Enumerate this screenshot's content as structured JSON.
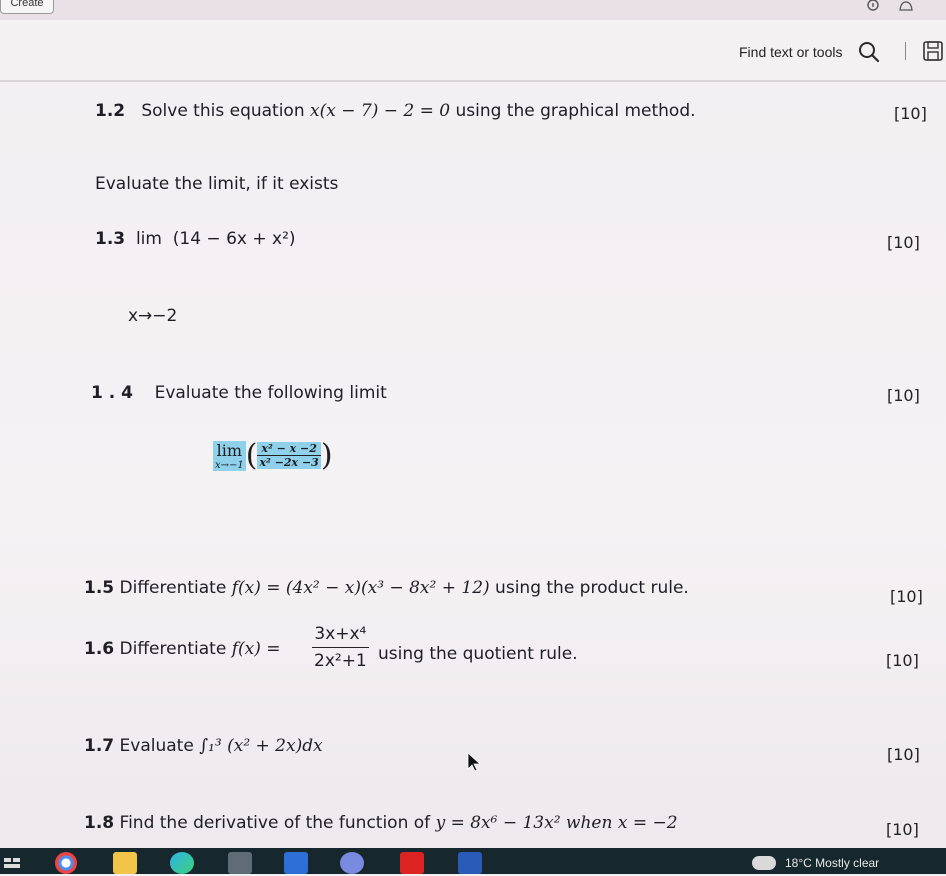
{
  "header": {
    "create_label": "Create",
    "find_label": "Find text or tools"
  },
  "icons": [
    "search-icon",
    "save-icon",
    "pin-icon",
    "bell-icon",
    "cursor-arrow-icon"
  ],
  "questions": {
    "q12": {
      "num": "1.2",
      "text_a": "Solve this equation ",
      "math": "x(x − 7) − 2 = 0",
      "text_b": " using the graphical method.",
      "mark": "[10]"
    },
    "section_title": "Evaluate the limit, if it exists",
    "q13": {
      "num": "1.3",
      "lim": "lim",
      "expr": "(14 − 6x + x²)",
      "sub": "x→−2",
      "mark": "[10]"
    },
    "q14": {
      "num": "1 . 4",
      "text": "Evaluate the following limit",
      "lim": "lim",
      "lim_sub": "x→−1",
      "num_expr": "x² − x −2",
      "den_expr": "x² −2x −3",
      "mark": "[10]"
    },
    "q15": {
      "num": "1.5",
      "text_a": "Differentiate ",
      "math": "f(x) = (4x² − x)(x³ − 8x² + 12)",
      "text_b": " using the product rule.",
      "mark": "[10]"
    },
    "q16": {
      "num": "1.6",
      "text_a": "Differentiate ",
      "math": "f(x) =",
      "num_expr": "3x+x⁴",
      "den_expr": "2x²+1",
      "text_b": "using the quotient rule.",
      "mark": "[10]"
    },
    "q17": {
      "num": "1.7",
      "text_a": "Evaluate ",
      "math": "∫₁³ (x² + 2x)dx",
      "mark": "[10]"
    },
    "q18": {
      "num": "1.8",
      "text_a": "Find the derivative of the function of ",
      "math": "y = 8x⁶ − 13x² when x = −2",
      "mark": "[10]"
    }
  },
  "taskbar": {
    "weather": "18°C  Mostly clear",
    "apps": [
      "task-view",
      "chrome",
      "file-explorer",
      "edge",
      "store",
      "mail",
      "teams",
      "acrobat",
      "word"
    ]
  },
  "colors": {
    "highlight": "#8fd0ea",
    "taskbar": "#17272e"
  }
}
